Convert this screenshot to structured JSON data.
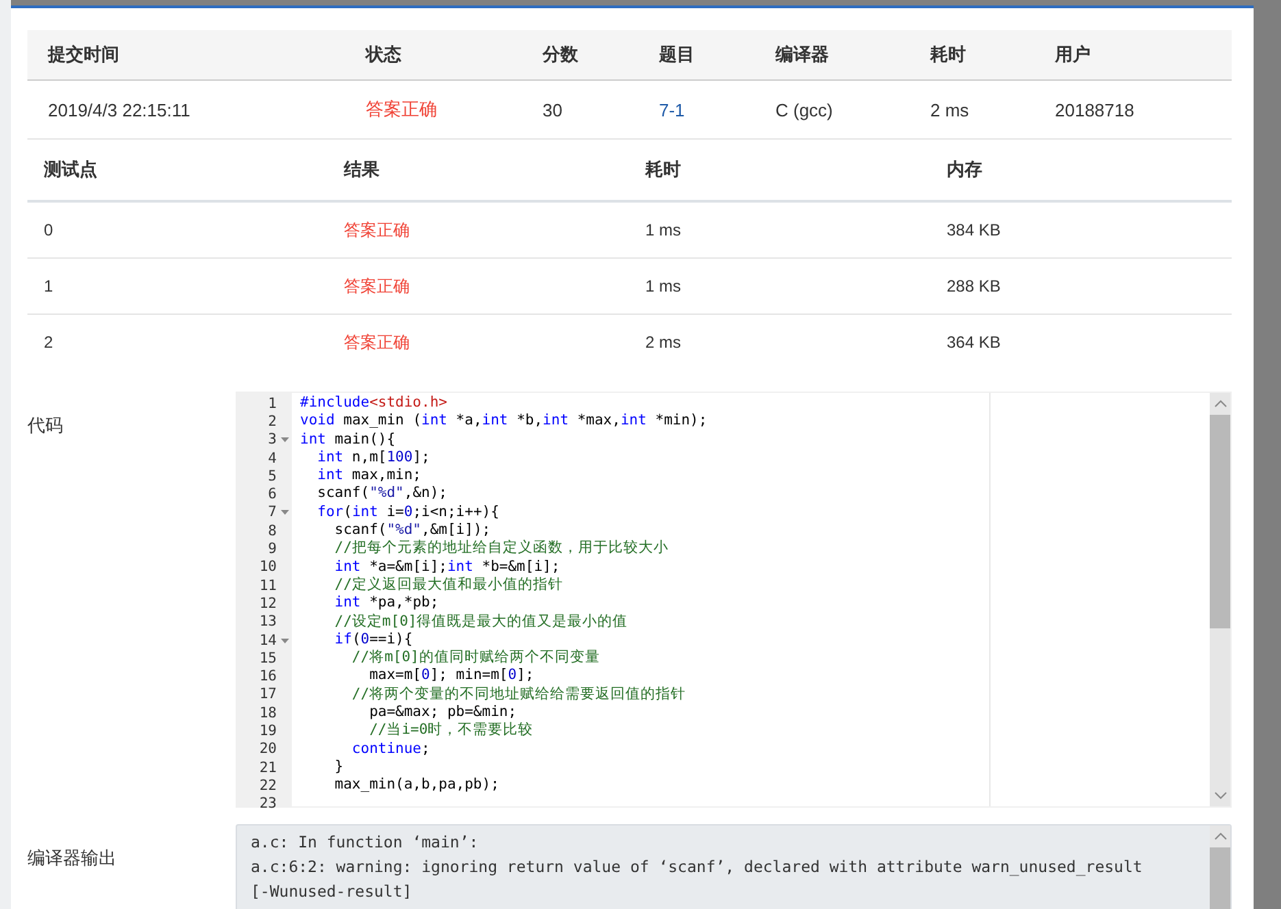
{
  "submission": {
    "columns": [
      "提交时间",
      "状态",
      "分数",
      "题目",
      "编译器",
      "耗时",
      "用户"
    ],
    "row": {
      "time": "2019/4/3 22:15:11",
      "status": "答案正确",
      "score": "30",
      "problem": "7-1",
      "compiler": "C (gcc)",
      "duration": "2 ms",
      "user": "20188718"
    }
  },
  "tests": {
    "columns": [
      "测试点",
      "结果",
      "耗时",
      "内存"
    ],
    "rows": [
      {
        "case": "0",
        "result": "答案正确",
        "time": "1 ms",
        "memory": "384 KB"
      },
      {
        "case": "1",
        "result": "答案正确",
        "time": "1 ms",
        "memory": "288 KB"
      },
      {
        "case": "2",
        "result": "答案正确",
        "time": "2 ms",
        "memory": "364 KB"
      }
    ]
  },
  "code": {
    "label": "代码",
    "lines": [
      {
        "num": "1",
        "foldable": false,
        "tokens": [
          {
            "kind": "keyword",
            "text": "#include"
          },
          {
            "kind": "header",
            "text": "<stdio.h>"
          }
        ]
      },
      {
        "num": "2",
        "foldable": false,
        "tokens": [
          {
            "kind": "keyword",
            "text": "void"
          },
          {
            "kind": "plain",
            "text": " max_min ("
          },
          {
            "kind": "keyword",
            "text": "int"
          },
          {
            "kind": "plain",
            "text": " *a,"
          },
          {
            "kind": "keyword",
            "text": "int"
          },
          {
            "kind": "plain",
            "text": " *b,"
          },
          {
            "kind": "keyword",
            "text": "int"
          },
          {
            "kind": "plain",
            "text": " *max,"
          },
          {
            "kind": "keyword",
            "text": "int"
          },
          {
            "kind": "plain",
            "text": " *min);"
          }
        ]
      },
      {
        "num": "3",
        "foldable": true,
        "tokens": [
          {
            "kind": "keyword",
            "text": "int"
          },
          {
            "kind": "plain",
            "text": " main(){"
          }
        ]
      },
      {
        "num": "4",
        "foldable": false,
        "tokens": [
          {
            "kind": "keyword",
            "text": "  int"
          },
          {
            "kind": "plain",
            "text": " n,m["
          },
          {
            "kind": "number",
            "text": "100"
          },
          {
            "kind": "plain",
            "text": "];"
          }
        ]
      },
      {
        "num": "5",
        "foldable": false,
        "tokens": [
          {
            "kind": "keyword",
            "text": "  int"
          },
          {
            "kind": "plain",
            "text": " max,min;"
          }
        ]
      },
      {
        "num": "6",
        "foldable": false,
        "tokens": [
          {
            "kind": "plain",
            "text": "  scanf("
          },
          {
            "kind": "string",
            "text": "\"%d\""
          },
          {
            "kind": "plain",
            "text": ",&n);"
          }
        ]
      },
      {
        "num": "7",
        "foldable": true,
        "tokens": [
          {
            "kind": "keyword",
            "text": "  for"
          },
          {
            "kind": "plain",
            "text": "("
          },
          {
            "kind": "keyword",
            "text": "int"
          },
          {
            "kind": "plain",
            "text": " i="
          },
          {
            "kind": "number",
            "text": "0"
          },
          {
            "kind": "plain",
            "text": ";i<n;i++){"
          }
        ]
      },
      {
        "num": "8",
        "foldable": false,
        "tokens": [
          {
            "kind": "plain",
            "text": "    scanf("
          },
          {
            "kind": "string",
            "text": "\"%d\""
          },
          {
            "kind": "plain",
            "text": ",&m[i]);"
          }
        ]
      },
      {
        "num": "9",
        "foldable": false,
        "tokens": [
          {
            "kind": "comment",
            "text": "    //把每个元素的地址给自定义函数，用于比较大小"
          }
        ]
      },
      {
        "num": "10",
        "foldable": false,
        "tokens": [
          {
            "kind": "keyword",
            "text": "    int"
          },
          {
            "kind": "plain",
            "text": " *a=&m[i];"
          },
          {
            "kind": "keyword",
            "text": "int"
          },
          {
            "kind": "plain",
            "text": " *b=&m[i];"
          }
        ]
      },
      {
        "num": "11",
        "foldable": false,
        "tokens": [
          {
            "kind": "comment",
            "text": "    //定义返回最大值和最小值的指针"
          }
        ]
      },
      {
        "num": "12",
        "foldable": false,
        "tokens": [
          {
            "kind": "keyword",
            "text": "    int"
          },
          {
            "kind": "plain",
            "text": " *pa,*pb;"
          }
        ]
      },
      {
        "num": "13",
        "foldable": false,
        "tokens": [
          {
            "kind": "comment",
            "text": "    //设定m[0]得值既是最大的值又是最小的值"
          }
        ]
      },
      {
        "num": "14",
        "foldable": true,
        "tokens": [
          {
            "kind": "keyword",
            "text": "    if"
          },
          {
            "kind": "plain",
            "text": "("
          },
          {
            "kind": "number",
            "text": "0"
          },
          {
            "kind": "plain",
            "text": "==i){"
          }
        ]
      },
      {
        "num": "15",
        "foldable": false,
        "tokens": [
          {
            "kind": "comment",
            "text": "      //将m[0]的值同时赋给两个不同变量"
          }
        ]
      },
      {
        "num": "16",
        "foldable": false,
        "tokens": [
          {
            "kind": "plain",
            "text": "        max=m["
          },
          {
            "kind": "number",
            "text": "0"
          },
          {
            "kind": "plain",
            "text": "]; min=m["
          },
          {
            "kind": "number",
            "text": "0"
          },
          {
            "kind": "plain",
            "text": "];"
          }
        ]
      },
      {
        "num": "17",
        "foldable": false,
        "tokens": [
          {
            "kind": "comment",
            "text": "      //将两个变量的不同地址赋给给需要返回值的指针"
          }
        ]
      },
      {
        "num": "18",
        "foldable": false,
        "tokens": [
          {
            "kind": "plain",
            "text": "        pa=&max; pb=&min;"
          }
        ]
      },
      {
        "num": "19",
        "foldable": false,
        "tokens": [
          {
            "kind": "comment",
            "text": "        //当i=0时，不需要比较"
          }
        ]
      },
      {
        "num": "20",
        "foldable": false,
        "tokens": [
          {
            "kind": "keyword",
            "text": "      continue"
          },
          {
            "kind": "plain",
            "text": ";"
          }
        ]
      },
      {
        "num": "21",
        "foldable": false,
        "tokens": [
          {
            "kind": "plain",
            "text": "    }"
          }
        ]
      },
      {
        "num": "22",
        "foldable": false,
        "tokens": [
          {
            "kind": "plain",
            "text": "    max_min(a,b,pa,pb);"
          }
        ]
      },
      {
        "num": "23",
        "foldable": false
      }
    ]
  },
  "compiler_output": {
    "label": "编译器输出",
    "lines": [
      "a.c: In function ‘main’:",
      "a.c:6:2: warning: ignoring return value of ‘scanf’, declared with attribute warn_unused_result",
      "[-Wunused-result]"
    ]
  }
}
